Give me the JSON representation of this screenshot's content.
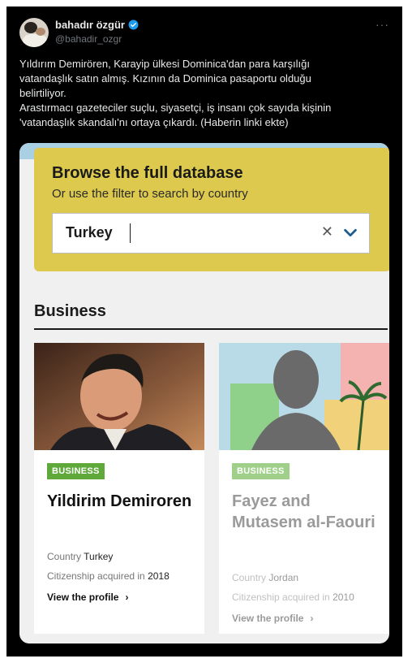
{
  "tweet": {
    "author_name": "bahadır özgür",
    "handle": "@bahadir_ozgr",
    "more_icon": "more-horizontal-icon",
    "text_lines": [
      "Yıldırım Demirören, Karayip ülkesi Dominica'dan para karşılığı",
      "vatandaşlık satın almış. Kızının da Dominica pasaportu olduğu",
      "belirtiliyor.",
      "Arastırmacı gazeteciler suçlu, siyasetçi, iş insanı çok sayıda kişinin",
      "'vatandaşlık skandalı'nı ortaya çıkardı. (Haberin linki ekte)"
    ]
  },
  "media": {
    "database": {
      "title": "Browse the full database",
      "subtitle": "Or use the filter to search by country",
      "search_value": "Turkey",
      "clear_icon": "close-icon",
      "dropdown_icon": "chevron-down-icon"
    },
    "section_title": "Business",
    "cards": [
      {
        "badge": "BUSINESS",
        "name": "Yildirim Demiroren",
        "country_label": "Country",
        "country": "Turkey",
        "citizenship_label": "Citizenship acquired in",
        "citizenship_year": "2018",
        "link_label": "View the profile"
      },
      {
        "badge": "BUSINESS",
        "name": "Fayez and Mutasem al-Faouri",
        "country_label": "Country",
        "country": "Jordan",
        "citizenship_label": "Citizenship acquired in",
        "citizenship_year": "2010",
        "link_label": "View the profile"
      }
    ]
  },
  "colors": {
    "background": "#000000",
    "database_box": "#dcc94e",
    "badge_green": "#5fa83a",
    "verified_blue": "#1d9bf0",
    "chevron_blue": "#1f5d8f"
  }
}
